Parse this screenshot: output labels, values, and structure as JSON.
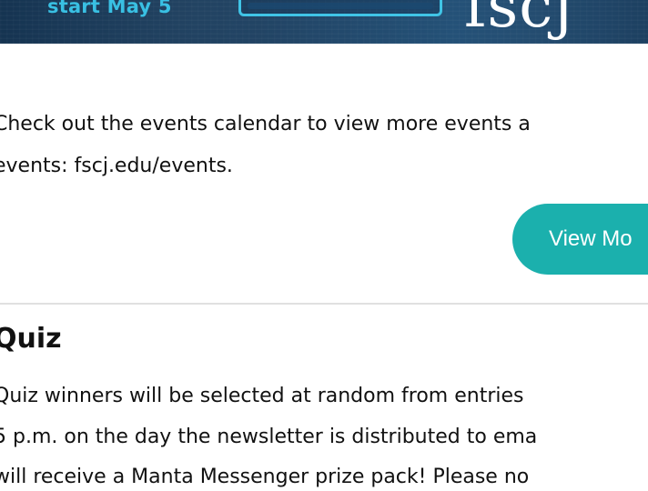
{
  "banner": {
    "date_text": "start May 5",
    "logo_text": "fscj",
    "cta_label": ""
  },
  "events": {
    "lines": [
      "Check out the events calendar to view more events a",
      "events: fscj.edu/events."
    ],
    "button_label": "View Mo"
  },
  "quiz": {
    "title": "Quiz",
    "lines": [
      "Quiz winners will be selected at random from entries",
      "5 p.m. on the day the newsletter is distributed to ema",
      "will receive a Manta Messenger prize pack! Please no"
    ]
  },
  "colors": {
    "banner_bg": "#163a5c",
    "accent_cyan": "#39c0e3",
    "button_teal": "#1bb0ad",
    "divider": "#e0e0e0",
    "text": "#111111"
  }
}
